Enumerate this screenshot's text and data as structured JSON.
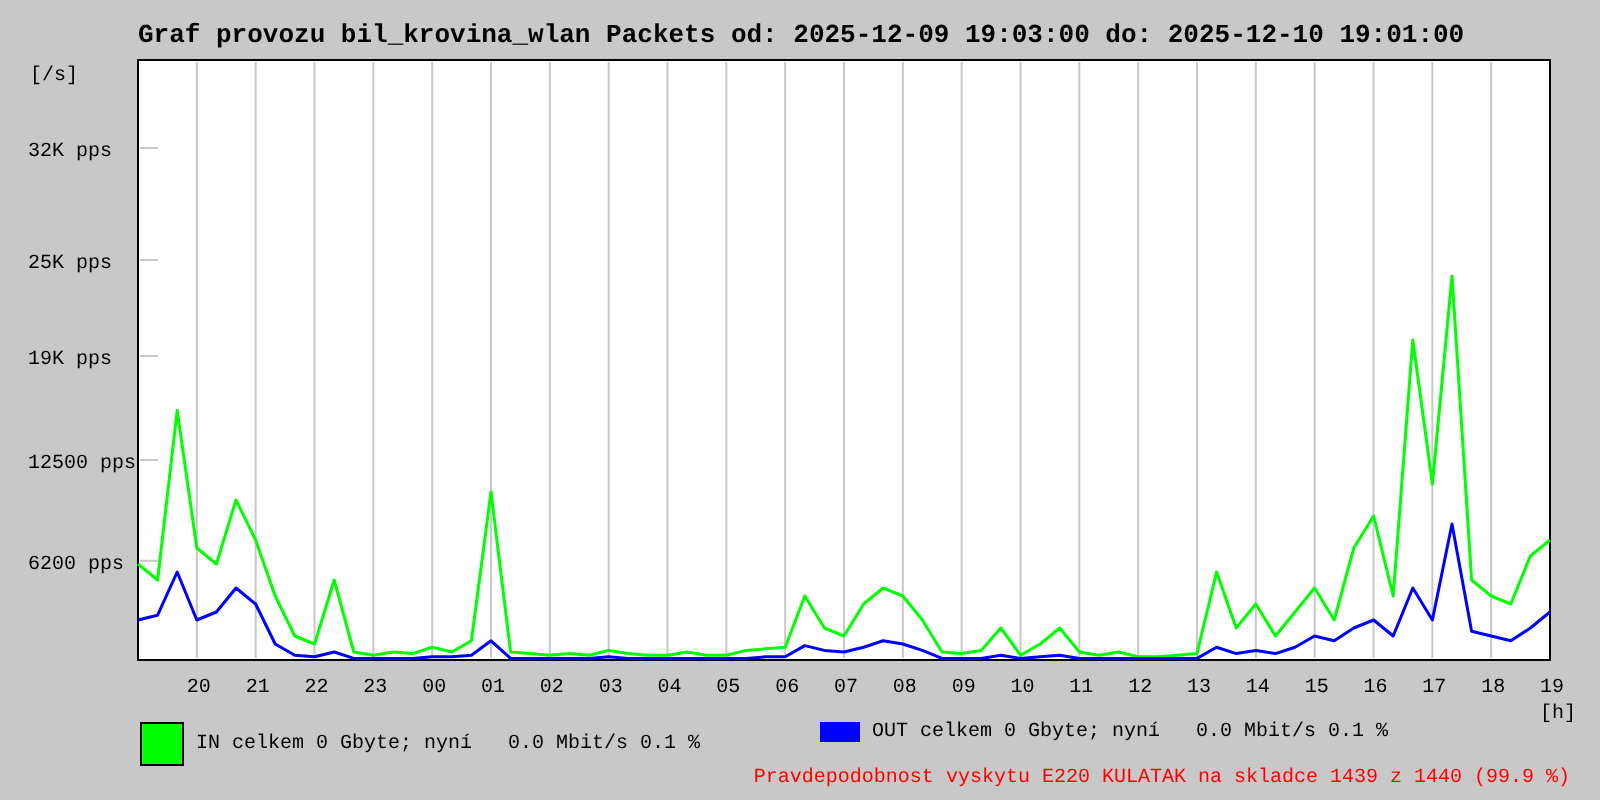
{
  "title": "Graf provozu bil_krovina_wlan Packets od: 2025-12-09 19:03:00 do: 2025-12-10 19:01:00",
  "chart_data": {
    "type": "line",
    "ylabel": "[/s]",
    "xlabel": "[h]",
    "grid": true,
    "ylim": [
      0,
      37500
    ],
    "categories": [
      null,
      null,
      null,
      "20",
      null,
      null,
      "21",
      null,
      null,
      "22",
      null,
      null,
      "23",
      null,
      null,
      "00",
      null,
      null,
      "01",
      null,
      null,
      "02",
      null,
      null,
      "03",
      null,
      null,
      "04",
      null,
      null,
      "05",
      null,
      null,
      "06",
      null,
      null,
      "07",
      null,
      null,
      "08",
      null,
      null,
      "09",
      null,
      null,
      "10",
      null,
      null,
      "11",
      null,
      null,
      "12",
      null,
      null,
      "13",
      null,
      null,
      "14",
      null,
      null,
      "15",
      null,
      null,
      "16",
      null,
      null,
      "17",
      null,
      null,
      "18",
      null,
      null,
      "19"
    ],
    "yticks": [
      {
        "value": 6200,
        "label": "6200 pps"
      },
      {
        "value": 12500,
        "label": "12500 pps"
      },
      {
        "value": 19000,
        "label": "19K pps"
      },
      {
        "value": 25000,
        "label": "25K pps"
      },
      {
        "value": 32000,
        "label": "32K pps"
      }
    ],
    "series": [
      {
        "name": "IN",
        "color": "#00ff00",
        "values": [
          6000,
          5000,
          15600,
          7000,
          6000,
          10000,
          7500,
          4000,
          1500,
          1000,
          5000,
          500,
          300,
          500,
          400,
          800,
          500,
          1200,
          10500,
          500,
          400,
          300,
          400,
          300,
          600,
          400,
          300,
          300,
          500,
          300,
          300,
          600,
          700,
          800,
          4000,
          2000,
          1500,
          3500,
          4500,
          4000,
          2500,
          500,
          400,
          600,
          2000,
          300,
          1000,
          2000,
          500,
          300,
          500,
          200,
          200,
          300,
          400,
          5500,
          2000,
          3500,
          1500,
          3000,
          4500,
          2500,
          7000,
          9000,
          4000,
          20000,
          11000,
          24000,
          5000,
          4000,
          3500,
          6500,
          7500
        ]
      },
      {
        "name": "OUT",
        "color": "#0000ff",
        "values": [
          2500,
          2800,
          5500,
          2500,
          3000,
          4500,
          3500,
          1000,
          300,
          200,
          500,
          100,
          100,
          100,
          100,
          200,
          200,
          300,
          1200,
          100,
          100,
          100,
          100,
          100,
          200,
          100,
          100,
          100,
          100,
          100,
          100,
          100,
          200,
          200,
          900,
          600,
          500,
          800,
          1200,
          1000,
          600,
          100,
          100,
          100,
          300,
          100,
          200,
          300,
          100,
          100,
          100,
          100,
          100,
          100,
          100,
          800,
          400,
          600,
          400,
          800,
          1500,
          1200,
          2000,
          2500,
          1500,
          4500,
          2500,
          8500,
          1800,
          1500,
          1200,
          2000,
          3000
        ]
      }
    ]
  },
  "legend": [
    {
      "text": "celkem 0 Gbyte; nyní   0.0 Mbit/s 0.1 %",
      "kind": "box"
    },
    {
      "text": "celkem 0 Gbyte; nyní   0.0 Mbit/s 0.1 %",
      "kind": "bar"
    }
  ],
  "note": "Pravdepodobnost vyskytu E220 KULATAK na skladce 1439 z 1440 (99.9 %)"
}
